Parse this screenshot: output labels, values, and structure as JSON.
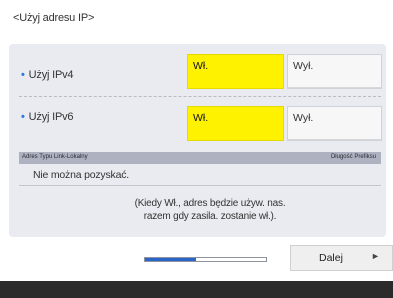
{
  "screen": {
    "title": "<Użyj adresu IP>"
  },
  "ipv4": {
    "label": "Użyj IPv4",
    "on_label": "Wł.",
    "off_label": "Wył.",
    "selected": "on"
  },
  "ipv6": {
    "label": "Użyj IPv6",
    "on_label": "Wł.",
    "off_label": "Wył.",
    "selected": "on"
  },
  "table": {
    "headers": [
      "Adres Typu Link-Lokalny",
      "Długość Prefiksu"
    ],
    "row_value": "Nie można pozyskać."
  },
  "note": {
    "line1": "(Kiedy Wł., adres będzie używ. nas.",
    "line2": "razem gdy zasila. zostanie wł.)."
  },
  "progress": {
    "fraction": 0.42
  },
  "next_button": {
    "label": "Dalej",
    "icon": "play-arrow-icon"
  },
  "colors": {
    "selected": "#fff200",
    "panel": "#e9ebf1",
    "accent": "#2a66c8",
    "bottom_bar": "#2b2b2b"
  }
}
